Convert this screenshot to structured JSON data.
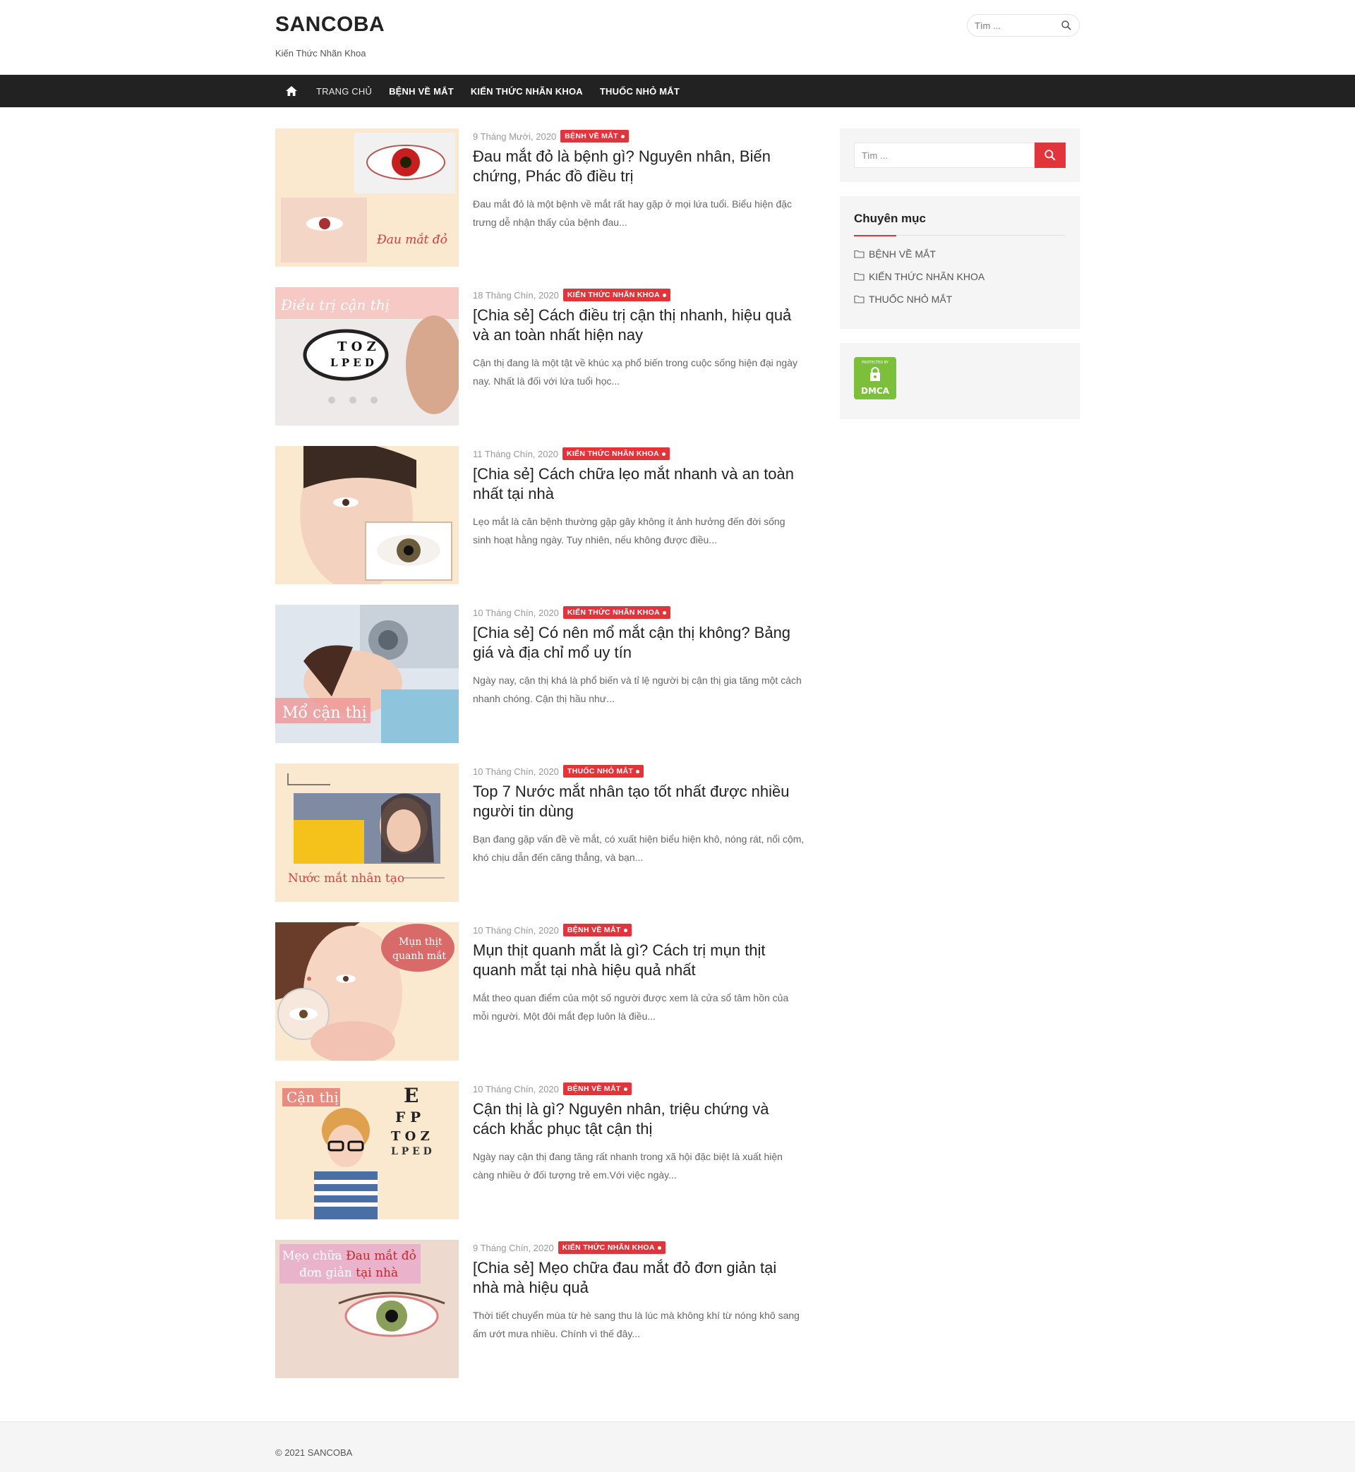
{
  "site": {
    "title": "SANCOBA",
    "description": "Kiến Thức Nhãn Khoa"
  },
  "header_search": {
    "placeholder": "Tìm ..."
  },
  "nav": {
    "home_icon": "home-icon",
    "items": [
      "TRANG CHỦ",
      "BỆNH VỀ MẮT",
      "KIẾN THỨC NHÃN KHOA",
      "THUỐC NHỎ MẮT"
    ]
  },
  "posts": [
    {
      "date": "9 Tháng Mười, 2020",
      "category": "BỆNH VỀ MẮT",
      "title": "Đau mắt đỏ là bệnh gì? Nguyên nhân, Biến chứng, Phác đồ điều trị",
      "excerpt": "Đau mắt đỏ là một bệnh về mắt rất hay gặp ở mọi lứa tuổi. Biểu hiện đặc trưng dễ nhận thấy của bệnh đau...",
      "image_text": "Đau mắt đỏ"
    },
    {
      "date": "18 Tháng Chín, 2020",
      "category": "KIẾN THỨC NHÃN KHOA",
      "title": "[Chia sẻ] Cách điều trị cận thị nhanh, hiệu quả và an toàn nhất hiện nay",
      "excerpt": "Cận thị đang là một tật về khúc xạ phổ biến trong cuộc sống hiện đại ngày nay. Nhất là đối với lứa tuổi học...",
      "image_text": "Điều trị cận thị"
    },
    {
      "date": "11 Tháng Chín, 2020",
      "category": "KIẾN THỨC NHÃN KHOA",
      "title": "[Chia sẻ] Cách chữa lẹo mắt nhanh và an toàn nhất tại nhà",
      "excerpt": "Lẹo mắt là căn bệnh thường gặp gây không ít ảnh hưởng đến đời sống sinh hoạt hằng ngày. Tuy nhiên, nếu không được điều...",
      "image_text": ""
    },
    {
      "date": "10 Tháng Chín, 2020",
      "category": "KIẾN THỨC NHÃN KHOA",
      "title": "[Chia sẻ] Có nên mổ mắt cận thị không? Bảng giá và địa chỉ mổ uy tín",
      "excerpt": "Ngày nay, cận thị khá là phổ biến và tỉ lệ người bị cận thị gia tăng một cách nhanh chóng. Cận thị hầu như...",
      "image_text": "Mổ cận thị"
    },
    {
      "date": "10 Tháng Chín, 2020",
      "category": "THUỐC NHỎ MẮT",
      "title": "Top 7 Nước mắt nhân tạo tốt nhất được nhiều người tin dùng",
      "excerpt": "Bạn đang gặp vấn đề về mắt, có xuất hiện biểu hiện khô, nóng rát, nổi cộm, khó chịu dẫn đến căng thẳng, và bạn...",
      "image_text": "Nước mắt nhân tạo"
    },
    {
      "date": "10 Tháng Chín, 2020",
      "category": "BỆNH VỀ MẮT",
      "title": "Mụn thịt quanh mắt là gì? Cách trị mụn thịt quanh mắt tại nhà hiệu quả nhất",
      "excerpt": "Mắt theo quan điểm của một số người được xem là cửa sổ tâm hồn của mỗi người. Một đôi mắt đẹp luôn là điều...",
      "image_text": "Mụn thịt quanh mắt"
    },
    {
      "date": "10 Tháng Chín, 2020",
      "category": "BỆNH VỀ MẮT",
      "title": "Cận thị là gì? Nguyên nhân, triệu chứng và cách khắc phục tật cận thị",
      "excerpt": "Ngày nay cận thị đang tăng rất nhanh trong xã hội đặc biệt là xuất hiện càng nhiều ở đối tượng trẻ em.Với việc ngày...",
      "image_text": "Cận thị"
    },
    {
      "date": "9 Tháng Chín, 2020",
      "category": "KIẾN THỨC NHÃN KHOA",
      "title": "[Chia sẻ] Mẹo chữa đau mắt đỏ đơn giản tại nhà mà hiệu quả",
      "excerpt": "Thời tiết chuyển mùa từ hè sang thu là lúc mà không khí từ nóng khô sang ẩm ướt mưa nhiều. Chính vì thế đây...",
      "image_text": "Mẹo chữa Đau mắt đỏ đơn giản tại nhà"
    }
  ],
  "sidebar": {
    "search_placeholder": "Tìm ...",
    "categories_title": "Chuyên mục",
    "categories": [
      "BỆNH VỀ MẮT",
      "KIẾN THỨC NHÃN KHOA",
      "THUỐC NHỎ MẮT"
    ],
    "dmca_label": "DMCA",
    "dmca_top": "PROTECTED BY"
  },
  "footer": {
    "text": "© 2021 SANCOBA"
  },
  "colors": {
    "accent": "#e2353b",
    "nav_bg": "#222222",
    "widget_bg": "#f5f5f5"
  }
}
